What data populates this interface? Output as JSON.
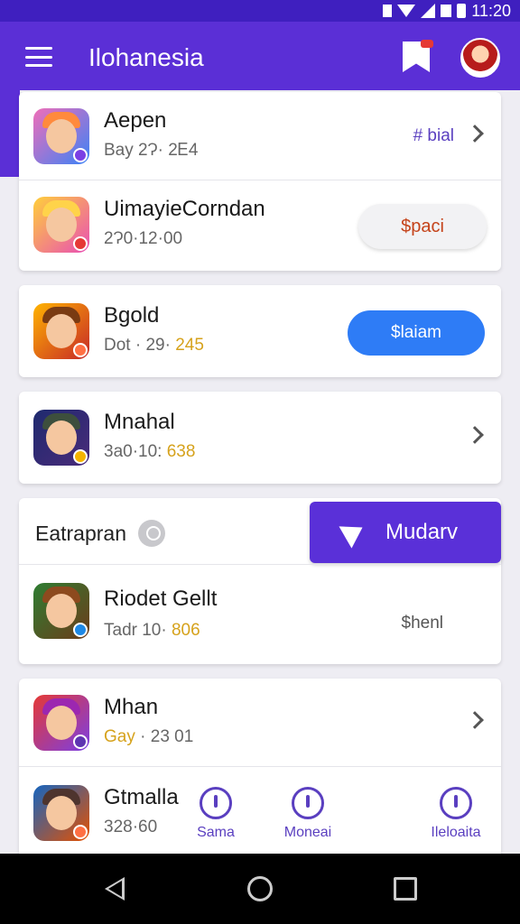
{
  "status_bar": {
    "time": "11:20"
  },
  "app_bar": {
    "title": "Ilohanesia"
  },
  "colors": {
    "primary": "#5b2fd6",
    "accent_blue": "#2e7cf6",
    "highlight": "#d6a21c",
    "tab_color": "#5a3fc0"
  },
  "list1": [
    {
      "name": "Aepen",
      "sub": "Bay 2Ɂ· 2Ꭼ4",
      "sub_highlight": "",
      "action": {
        "type": "tag",
        "label": "# bial"
      }
    },
    {
      "name": "UimayieCorndan",
      "sub": "2Ɂ0·12·00",
      "sub_highlight": "",
      "action": {
        "type": "pill",
        "label": "$paci"
      }
    }
  ],
  "card2": {
    "name": "Bgold",
    "sub": "Dot · 29·",
    "sub_highlight": "245",
    "button": "$laiam"
  },
  "card3": {
    "name": "Mnahal",
    "sub": "3a0·10:",
    "sub_highlight": "638"
  },
  "section": {
    "title": "Eatrapran",
    "share_label": "Mudarv",
    "row": {
      "name": "Riodet Gellt",
      "sub": "Tadr 10·",
      "sub_highlight": "806",
      "price": "$henl"
    }
  },
  "card5": [
    {
      "name": "Mhan",
      "sub_prefix": "Gay",
      "sub": "· 23 01"
    },
    {
      "name": "Gtmalla",
      "sub": "328·60"
    }
  ],
  "bottom_tabs": [
    {
      "label": "Sama",
      "icon": "clock-icon"
    },
    {
      "label": "Moneai",
      "icon": "info-icon"
    },
    {
      "label": "Ileloaita",
      "icon": "alert-icon"
    }
  ]
}
